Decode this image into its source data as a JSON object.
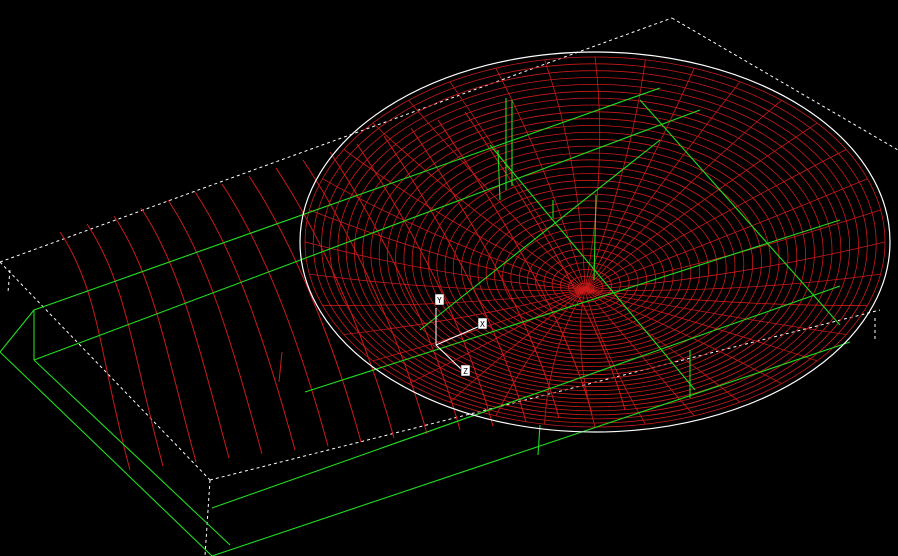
{
  "scene": {
    "background": "#000000",
    "colors": {
      "bounding_box": "#ffffff",
      "sphere_outline": "#ffffff",
      "mesh": "#cc1a1a",
      "frame": "#22dd22",
      "axes": "#ffffff"
    },
    "axes": {
      "labels": [
        "Y",
        "X",
        "Z"
      ]
    }
  }
}
